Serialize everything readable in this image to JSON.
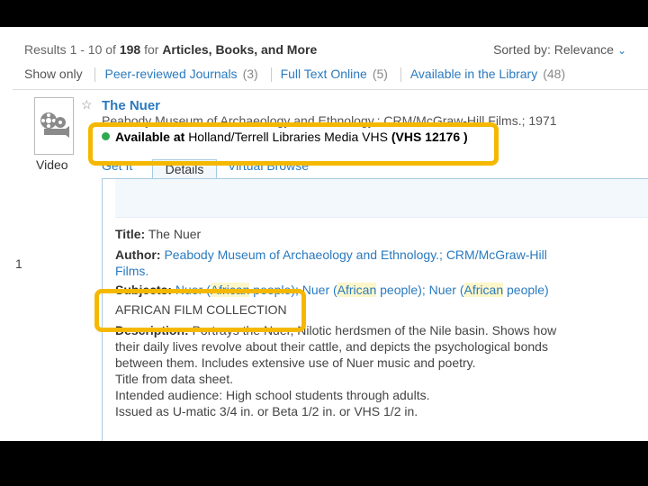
{
  "results_header": {
    "range_prefix": "Results 1 - 10 of ",
    "total": "198",
    "for_word": "for",
    "scope": "Articles, Books, and More"
  },
  "sort": {
    "label": "Sorted by:",
    "value": "Relevance"
  },
  "filters": {
    "show_only_label": "Show only",
    "items": [
      {
        "label": "Peer-reviewed Journals",
        "count": "(3)"
      },
      {
        "label": "Full Text Online",
        "count": "(5)"
      },
      {
        "label": "Available in the Library",
        "count": "(48)"
      }
    ]
  },
  "result": {
    "number": "1",
    "type": "Video",
    "title": "The Nuer",
    "publisher_line": "Peabody Museum of Archaeology and Ethnology.; CRM/McGraw-Hill Films.; 1971",
    "availability": {
      "status": "Available at",
      "location": "Holland/Terrell Libraries Media VHS",
      "call_number": "(VHS 12176 )"
    },
    "tabs": [
      "Get It",
      "Details",
      "Virtual Browse"
    ],
    "details": {
      "title_label": "Title:",
      "title_value": "The Nuer",
      "author_label": "Author:",
      "author_line1": "Peabody Museum of Archaeology and Ethnology.; CRM/McGraw-Hill",
      "author_line2": "Films.",
      "subjects_label": "Subjects:",
      "subject_1a": "Nuer (",
      "subject_1b": "African",
      "subject_1c": " people)",
      "subject_2a": "; Nuer (",
      "subject_2b": "African",
      "subject_2c": " people)",
      "subject_3a": "; Nuer (",
      "subject_3b": "African",
      "subject_3c": " people)",
      "collection": "AFRICAN FILM COLLECTION",
      "description_label": "Description:",
      "description_1": "Portrays the Nuer, Nilotic herdsmen of the Nile basin. Shows how",
      "description_2": "their daily lives revolve about their cattle, and depicts the psychological bonds",
      "description_3": "between them. Includes extensive use of Nuer music and poetry.",
      "note_1": "Title from data sheet.",
      "note_2": "Intended audience: High school students through adults.",
      "note_3": "Issued as U-matic 3/4 in. or Beta 1/2 in. or VHS 1/2 in."
    }
  },
  "colors": {
    "link": "#2a7abf",
    "highlight_box": "#f5b800",
    "available_dot": "#2fa84f",
    "term_highlight": "#fdf6c9"
  }
}
